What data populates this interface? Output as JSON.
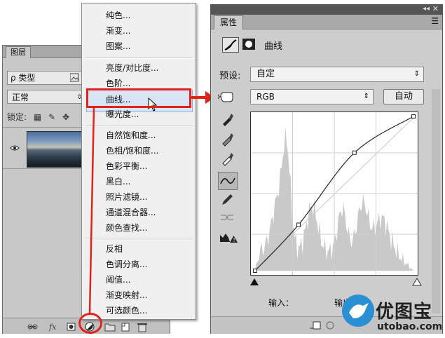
{
  "layers_panel": {
    "tab": "图层",
    "filter_label": "ρ 类型",
    "blend_mode": "正常",
    "lock_label": "锁定:"
  },
  "adjustment_menu": {
    "group1": [
      "纯色...",
      "渐变...",
      "图案..."
    ],
    "group2": [
      "亮度/对比度...",
      "色阶...",
      "曲线...",
      "曝光度..."
    ],
    "group3": [
      "自然饱和度...",
      "色相/饱和度...",
      "色彩平衡...",
      "黑白...",
      "照片滤镜...",
      "通道混合器...",
      "颜色查找..."
    ],
    "group4": [
      "反相",
      "色调分离...",
      "阈值...",
      "渐变映射...",
      "可选颜色..."
    ],
    "highlighted": "曲线..."
  },
  "properties_panel": {
    "tab": "属性",
    "title": "曲线",
    "preset_label": "预设:",
    "preset_value": "自定",
    "channel_value": "RGB",
    "auto_button": "自动",
    "input_label": "输入：",
    "output_label": "输出："
  },
  "curve": {
    "points": [
      [
        0,
        0
      ],
      [
        70,
        76
      ],
      [
        160,
        195
      ],
      [
        255,
        255
      ]
    ]
  },
  "watermark": {
    "brand": "优图宝",
    "url": "utobao.com"
  },
  "colors": {
    "highlight_red": "#e2231a",
    "menu_hover": "#d9e5f4",
    "watermark_blue": "#2b8fd3"
  }
}
